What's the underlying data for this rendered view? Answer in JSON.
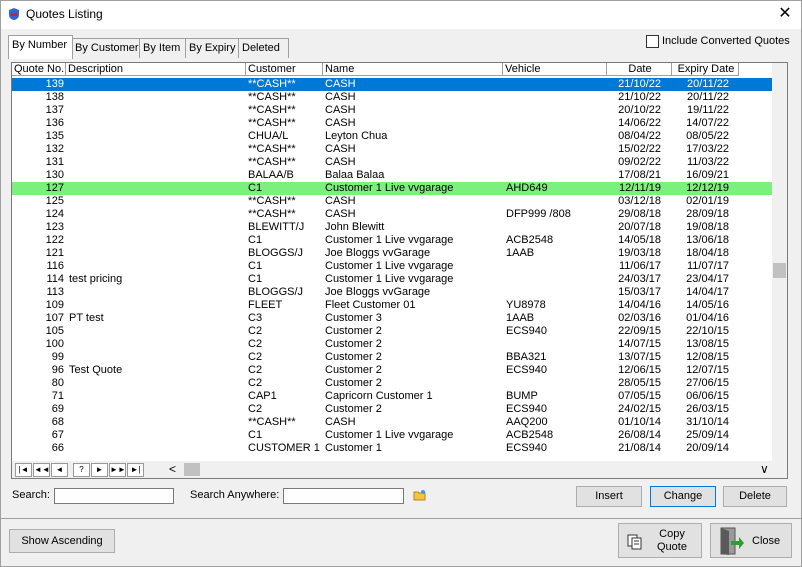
{
  "window": {
    "title": "Quotes Listing",
    "close_glyph": "✕"
  },
  "tabs": [
    "By Number",
    "By Customer",
    "By Item",
    "By Expiry",
    "Deleted"
  ],
  "include_converted": {
    "label": "Include Converted Quotes",
    "checked": false
  },
  "grid": {
    "columns": [
      "Quote No.",
      "Description",
      "Customer",
      "Name",
      "Vehicle",
      "Date",
      "Expiry Date"
    ],
    "rows": [
      [
        "139",
        "",
        "**CASH**",
        "CASH",
        "",
        "21/10/22",
        "20/11/22"
      ],
      [
        "138",
        "",
        "**CASH**",
        "CASH",
        "",
        "21/10/22",
        "20/11/22"
      ],
      [
        "137",
        "",
        "**CASH**",
        "CASH",
        "",
        "20/10/22",
        "19/11/22"
      ],
      [
        "136",
        "",
        "**CASH**",
        "CASH",
        "",
        "14/06/22",
        "14/07/22"
      ],
      [
        "135",
        "",
        "CHUA/L",
        "Leyton Chua",
        "",
        "08/04/22",
        "08/05/22"
      ],
      [
        "132",
        "",
        "**CASH**",
        "CASH",
        "",
        "15/02/22",
        "17/03/22"
      ],
      [
        "131",
        "",
        "**CASH**",
        "CASH",
        "",
        "09/02/22",
        "11/03/22"
      ],
      [
        "130",
        "",
        "BALAA/B",
        "Balaa Balaa",
        "",
        "17/08/21",
        "16/09/21"
      ],
      [
        "127",
        "",
        "C1",
        "Customer 1 Live vvgarage",
        "AHD649",
        "12/11/19",
        "12/12/19"
      ],
      [
        "125",
        "",
        "**CASH**",
        "CASH",
        "",
        "03/12/18",
        "02/01/19"
      ],
      [
        "124",
        "",
        "**CASH**",
        "CASH",
        "DFP999 /808",
        "29/08/18",
        "28/09/18"
      ],
      [
        "123",
        "",
        "BLEWITT/J",
        "John Blewitt",
        "",
        "20/07/18",
        "19/08/18"
      ],
      [
        "122",
        "",
        "C1",
        "Customer 1 Live vvgarage",
        "ACB2548",
        "14/05/18",
        "13/06/18"
      ],
      [
        "121",
        "",
        "BLOGGS/J",
        "Joe Bloggs vvGarage",
        "1AAB",
        "19/03/18",
        "18/04/18"
      ],
      [
        "116",
        "",
        "C1",
        "Customer 1 Live vvgarage",
        "",
        "11/06/17",
        "11/07/17"
      ],
      [
        "114",
        "test pricing",
        "C1",
        "Customer 1 Live vvgarage",
        "",
        "24/03/17",
        "23/04/17"
      ],
      [
        "113",
        "",
        "BLOGGS/J",
        "Joe Bloggs vvGarage",
        "",
        "15/03/17",
        "14/04/17"
      ],
      [
        "109",
        "",
        "FLEET",
        "Fleet Customer 01",
        "YU8978",
        "14/04/16",
        "14/05/16"
      ],
      [
        "107",
        "PT test",
        "C3",
        "Customer 3",
        "1AAB",
        "02/03/16",
        "01/04/16"
      ],
      [
        "105",
        "",
        "C2",
        "Customer 2",
        "ECS940",
        "22/09/15",
        "22/10/15"
      ],
      [
        "100",
        "",
        "C2",
        "Customer 2",
        "",
        "14/07/15",
        "13/08/15"
      ],
      [
        "99",
        "",
        "C2",
        "Customer 2",
        "BBA321",
        "13/07/15",
        "12/08/15"
      ],
      [
        "96",
        "Test Quote",
        "C2",
        "Customer 2",
        "ECS940",
        "12/06/15",
        "12/07/15"
      ],
      [
        "80",
        "",
        "C2",
        "Customer 2",
        "",
        "28/05/15",
        "27/06/15"
      ],
      [
        "71",
        "",
        "CAP1",
        "Capricorn Customer 1",
        "BUMP",
        "07/05/15",
        "06/06/15"
      ],
      [
        "69",
        "",
        "C2",
        "Customer 2",
        "ECS940",
        "24/02/15",
        "26/03/15"
      ],
      [
        "68",
        "",
        "**CASH**",
        "CASH",
        "AAQ200",
        "01/10/14",
        "31/10/14"
      ],
      [
        "67",
        "",
        "C1",
        "Customer 1 Live vvgarage",
        "ACB2548",
        "26/08/14",
        "25/09/14"
      ],
      [
        "66",
        "",
        "CUSTOMER 1",
        "Customer 1",
        "ECS940",
        "21/08/14",
        "20/09/14"
      ]
    ],
    "selected_row": 0,
    "highlighted_row": 8
  },
  "nav_buttons": [
    "|◄",
    "◄◄",
    "◄",
    "?",
    "►",
    "►►",
    "►|"
  ],
  "search": {
    "label": "Search:",
    "value": ""
  },
  "search_anywhere": {
    "label": "Search Anywhere:",
    "value": ""
  },
  "buttons": {
    "insert": "Insert",
    "change": "Change",
    "delete": "Delete",
    "show_ascending": "Show Ascending",
    "copy_quote_line1": "Copy",
    "copy_quote_line2": "Quote",
    "close": "Close"
  }
}
